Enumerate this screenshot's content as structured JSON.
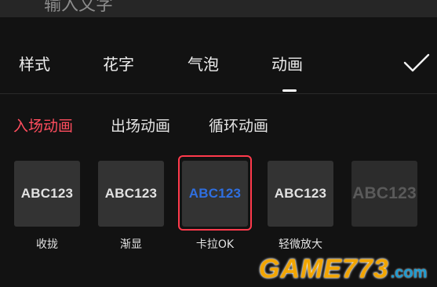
{
  "input": {
    "placeholder": "输入文字"
  },
  "tabs": [
    {
      "label": "样式"
    },
    {
      "label": "花字"
    },
    {
      "label": "气泡"
    },
    {
      "label": "动画",
      "active": true
    }
  ],
  "confirm_icon": "checkmark-icon",
  "subtabs": [
    {
      "label": "入场动画",
      "active": true
    },
    {
      "label": "出场动画"
    },
    {
      "label": "循环动画"
    }
  ],
  "animations": [
    {
      "sample": "ABC123",
      "label": "收拢"
    },
    {
      "sample": "ABC123",
      "label": "渐显"
    },
    {
      "sample": "ABC123",
      "label": "卡拉OK",
      "selected": true
    },
    {
      "sample": "ABC123",
      "label": "轻微放大"
    },
    {
      "sample": "ABC123",
      "label": ""
    }
  ],
  "colors": {
    "accent": "#ff4d5e",
    "selected_text": "#2f6fe0",
    "background": "#121212"
  },
  "watermark": {
    "main": "GAME773",
    "suffix": ".com"
  }
}
